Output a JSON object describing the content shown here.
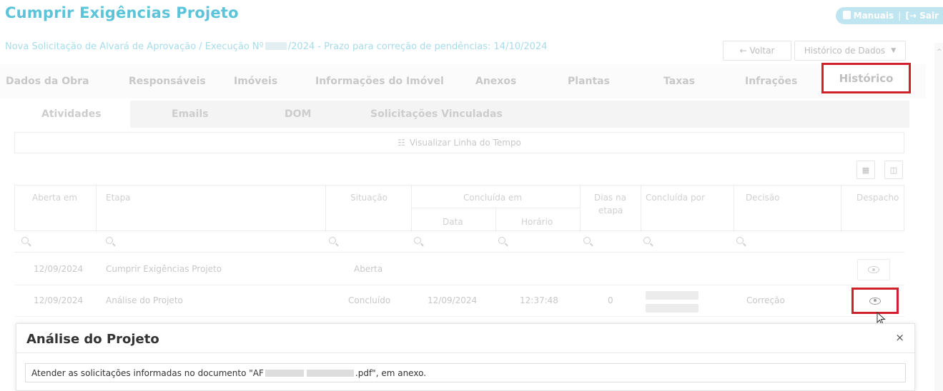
{
  "header": {
    "title": "Cumprir Exigências Projeto",
    "manuais_label": "Manuais",
    "sair_label": "Sair",
    "subtitle_prefix": "Nova Solicitação de Alvará de Aprovação / Execução Nº",
    "subtitle_suffix": "/2024 - Prazo para correção de pendências: 14/10/2024",
    "voltar_label": "Voltar",
    "historico_dados_label": "Histórico de Dados"
  },
  "main_tabs": [
    "Dados da Obra",
    "Responsáveis",
    "Imóveis",
    "Informações do Imóvel",
    "Anexos",
    "Plantas",
    "Taxas",
    "Infrações",
    "Histórico"
  ],
  "sub_tabs": [
    "Atividades",
    "Emails",
    "DOM",
    "Solicitações Vinculadas"
  ],
  "timeline_label": "Visualizar Linha do Tempo",
  "grid": {
    "headers": {
      "aberta_em": "Aberta em",
      "etapa": "Etapa",
      "situacao": "Situação",
      "concluida_em": "Concluída em",
      "data": "Data",
      "horario": "Horário",
      "dias_na": "Dias na",
      "etapa2": "etapa",
      "concluida_por": "Concluída por",
      "decisao": "Decisão",
      "despacho": "Despacho"
    },
    "rows": [
      {
        "aberta_em": "12/09/2024",
        "etapa": "Cumprir Exigências Projeto",
        "situacao": "Aberta",
        "data": "",
        "horario": "",
        "dias": "",
        "decisao": ""
      },
      {
        "aberta_em": "12/09/2024",
        "etapa": "Análise do Projeto",
        "situacao": "Concluído",
        "data": "12/09/2024",
        "horario": "12:37:48",
        "dias": "0",
        "decisao": "Correção"
      }
    ]
  },
  "panel": {
    "title": "Análise do Projeto",
    "close": "×",
    "text_prefix": "Atender as solicitações informadas no documento \"AF",
    "text_suffix": ".pdf\", em anexo."
  },
  "colors": {
    "accent": "#5bc4d9",
    "highlight": "#d0202e"
  }
}
